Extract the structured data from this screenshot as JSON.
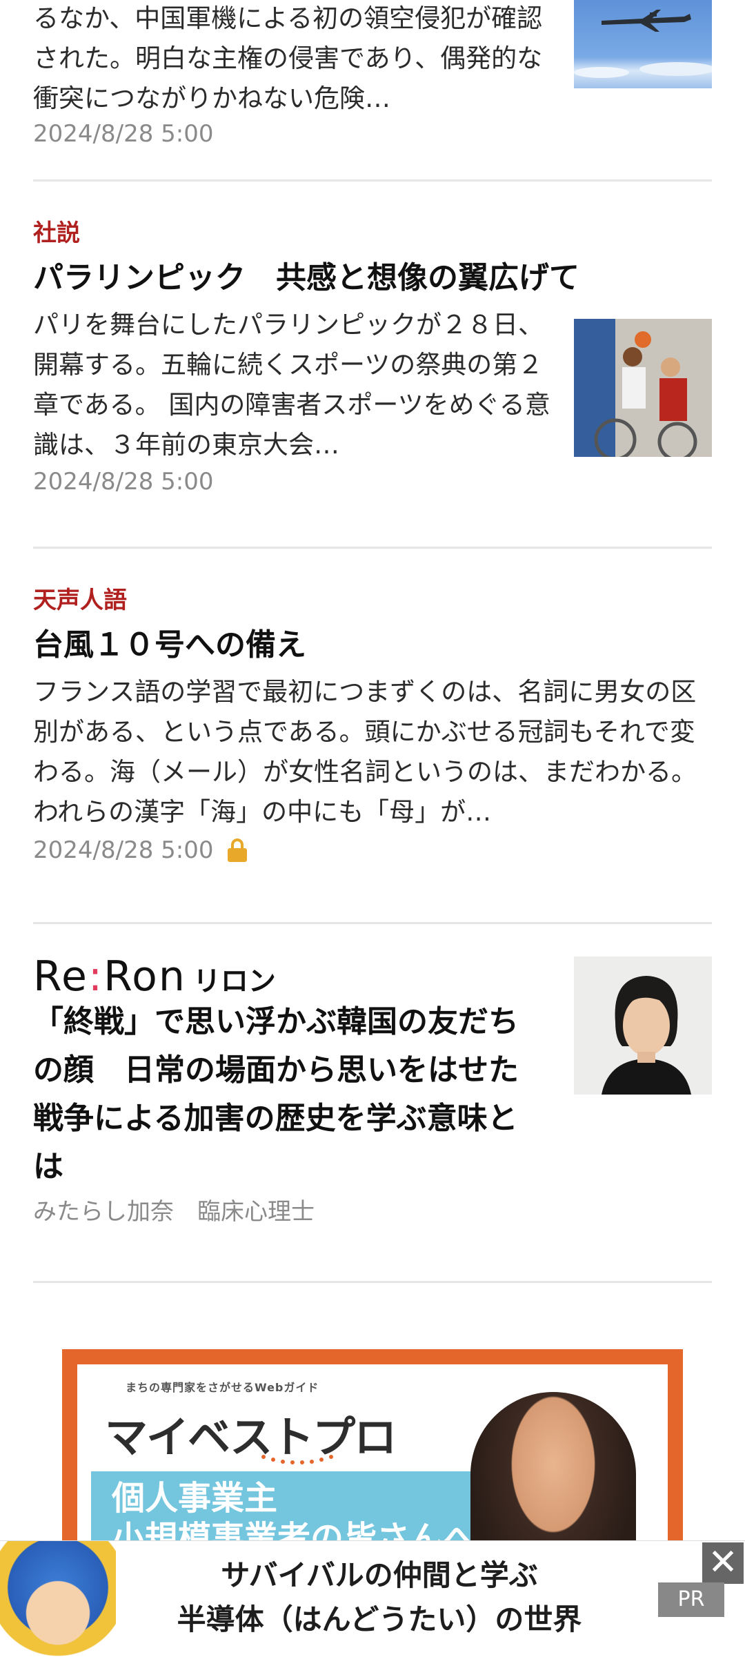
{
  "articles": [
    {
      "excerpt": "るなか、中国軍機による初の領空侵犯が確認された。明白な主権の侵害であり、偶発的な衝突につながりかねない危険…",
      "date": "2024/8/28 5:00"
    },
    {
      "category": "社説",
      "title": "パラリンピック　共感と想像の翼広げて",
      "excerpt": "パリを舞台にしたパラリンピックが２８日、開幕する。五輪に続くスポーツの祭典の第２章である。 国内の障害者スポーツをめぐる意識は、３年前の東京大会…",
      "date": "2024/8/28 5:00"
    },
    {
      "category": "天声人語",
      "title": "台風１０号への備え",
      "excerpt": "フランス語の学習で最初につまずくのは、名詞に男女の区別がある、という点である。頭にかぶせる冠詞もそれで変わる。海（メール）が女性名詞というのは、まだわかる。われらの漢字「海」の中にも「母」が…",
      "date": "2024/8/28 5:00",
      "lock_icon": "lock-icon"
    },
    {
      "brand_logo": "Re:Ron",
      "brand_kana": "リロン",
      "title": "「終戦」で思い浮かぶ韓国の友だちの顔　日常の場面から思いをはせた　戦争による加害の歴史を学ぶ意味とは",
      "author": "みたらし加奈　臨床心理士"
    }
  ],
  "ad": {
    "small_text": "まちの専門家をさがせるWebガイド",
    "title": "マイベストプロ",
    "band_text": "個人事業主\n小規模事業者の皆さんへ"
  },
  "banner": {
    "line1": "サバイバルの仲間と学ぶ",
    "line2": "半導体（はんどうたい）の世界",
    "pr_label": "PR",
    "close_icon": "close-icon"
  },
  "colors": {
    "category": "#b0201e",
    "lock": "#e8a92a",
    "ad_border": "#e5662b",
    "ad_band": "#74c5de"
  }
}
